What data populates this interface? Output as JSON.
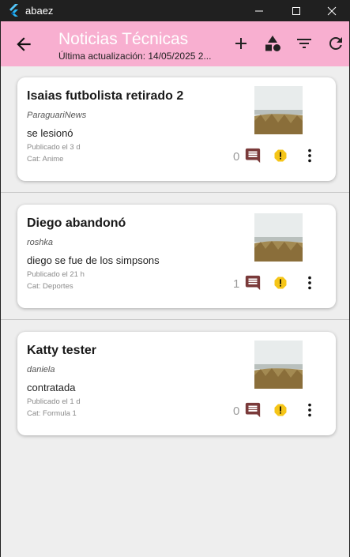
{
  "window": {
    "app_name": "abaez"
  },
  "appbar": {
    "title": "Noticias Técnicas",
    "subtitle": "Última actualización: 14/05/2025 2..."
  },
  "news": [
    {
      "title": "Isaias futbolista retirado 2",
      "source": "ParaguariNews",
      "description": "se lesionó",
      "published": "Publicado el 3 d",
      "category": "Cat: Anime",
      "comments": "0"
    },
    {
      "title": "Diego abandonó",
      "source": "roshka",
      "description": "diego se fue de los simpsons",
      "published": "Publicado el 21 h",
      "category": "Cat: Deportes",
      "comments": "1"
    },
    {
      "title": "Katty tester",
      "source": "daniela",
      "description": "contratada",
      "published": "Publicado el 1 d",
      "category": "Cat: Formula 1",
      "comments": "0"
    }
  ],
  "icons": {
    "back": "arrow-back-icon",
    "add": "add-icon",
    "categories": "category-shapes-icon",
    "filter": "filter-icon",
    "refresh": "refresh-icon",
    "comment": "comment-icon",
    "alert": "report-icon",
    "more": "more-vert-icon"
  },
  "colors": {
    "appbar": "#f8afd0",
    "comment": "#7a3a3a",
    "alert": "#f5c518",
    "background": "#eeeeee"
  }
}
